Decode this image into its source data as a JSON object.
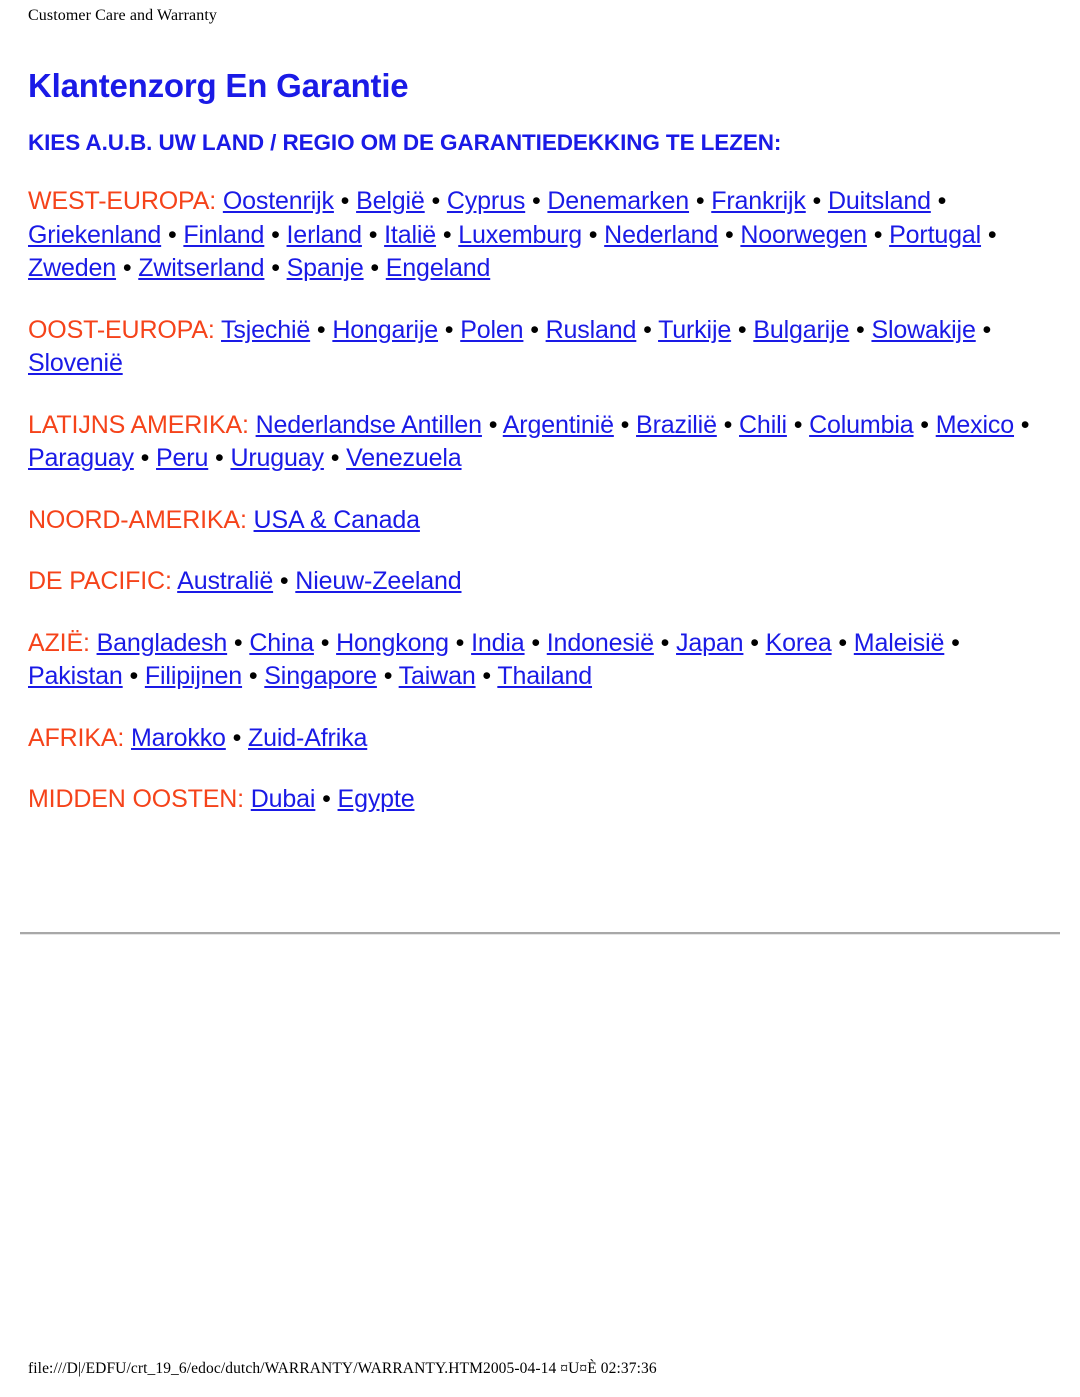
{
  "document": {
    "running_header": "Customer Care and Warranty",
    "running_footer": "file:///D|/EDFU/crt_19_6/edoc/dutch/WARRANTY/WARRANTY.HTM2005-04-14 ¤U¤È 02:37:36"
  },
  "colors": {
    "title_blue": "#1a1ae6",
    "link_blue": "#1a1ae6",
    "region_orange": "#f5431a",
    "text_black": "#000000",
    "page_background": "#ffffff",
    "divider_gray": "#a8a8a8"
  },
  "page": {
    "title": "Klantenzorg En Garantie",
    "instruction": "KIES A.U.B. UW LAND / REGIO OM DE GARANTIEDEKKING TE LEZEN:",
    "separator": "•"
  },
  "regions": [
    {
      "label": "WEST-EUROPA:",
      "countries": [
        "Oostenrijk",
        "België",
        "Cyprus",
        "Denemarken",
        "Frankrijk",
        "Duitsland",
        "Griekenland",
        "Finland",
        "Ierland",
        "Italië",
        "Luxemburg",
        "Nederland",
        "Noorwegen",
        "Portugal",
        "Zweden",
        "Zwitserland",
        "Spanje",
        "Engeland"
      ]
    },
    {
      "label": "OOST-EUROPA:",
      "countries": [
        "Tsjechië",
        "Hongarije",
        "Polen",
        "Rusland",
        "Turkije",
        "Bulgarije",
        "Slowakije",
        "Slovenië"
      ]
    },
    {
      "label": "LATIJNS AMERIKA:",
      "countries": [
        "Nederlandse Antillen",
        "Argentinië",
        "Brazilië",
        "Chili",
        "Columbia",
        "Mexico",
        "Paraguay",
        "Peru",
        "Uruguay",
        "Venezuela"
      ]
    },
    {
      "label": "NOORD-AMERIKA:",
      "countries": [
        "USA & Canada"
      ]
    },
    {
      "label": "DE PACIFIC:",
      "countries": [
        "Australië",
        "Nieuw-Zeeland"
      ]
    },
    {
      "label": "AZIË:",
      "countries": [
        "Bangladesh",
        "China",
        "Hongkong",
        "India",
        "Indonesië",
        "Japan",
        "Korea",
        "Maleisië",
        "Pakistan",
        "Filipijnen",
        "Singapore",
        "Taiwan",
        "Thailand"
      ]
    },
    {
      "label": "AFRIKA:",
      "countries": [
        "Marokko",
        "Zuid-Afrika"
      ]
    },
    {
      "label": "MIDDEN OOSTEN:",
      "countries": [
        "Dubai",
        "Egypte"
      ]
    }
  ]
}
